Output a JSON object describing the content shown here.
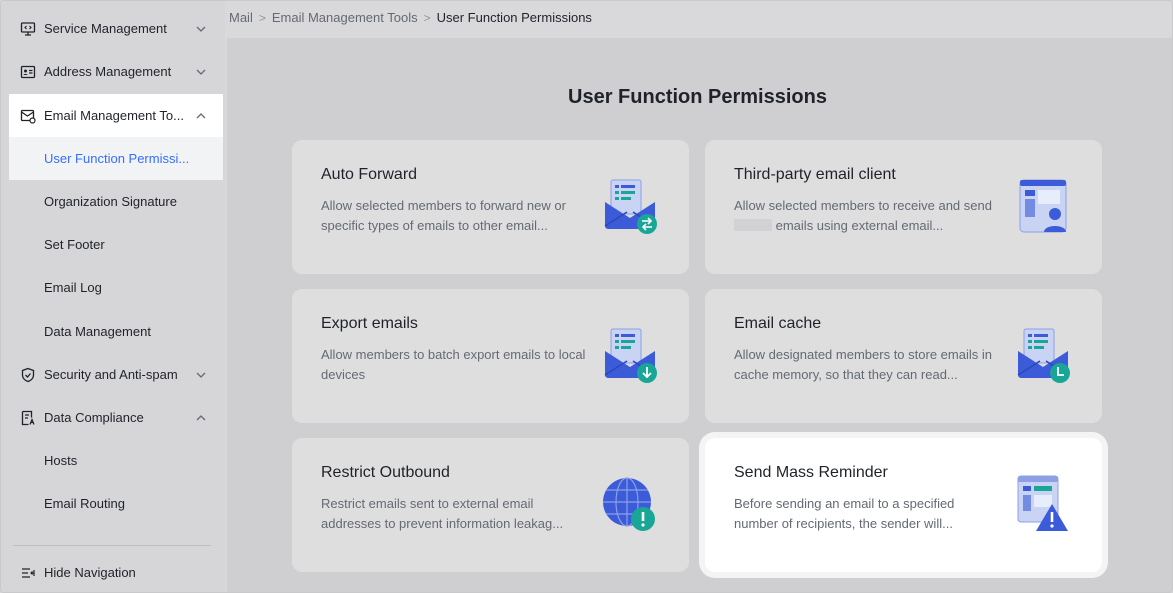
{
  "sidebar": {
    "items": [
      {
        "label": "Service Management",
        "icon": "code-monitor-icon",
        "expanded": false
      },
      {
        "label": "Address Management",
        "icon": "contact-card-icon",
        "expanded": false
      },
      {
        "label": "Email Management To...",
        "icon": "mail-settings-icon",
        "expanded": true
      },
      {
        "label": "User Function Permissi..."
      },
      {
        "label": "Organization Signature"
      },
      {
        "label": "Set Footer"
      },
      {
        "label": "Email Log"
      },
      {
        "label": "Data Management"
      },
      {
        "label": "Security and Anti-spam",
        "icon": "shield-check-icon",
        "expanded": false
      },
      {
        "label": "Data Compliance",
        "icon": "compliance-doc-icon",
        "expanded": true
      },
      {
        "label": "Hosts"
      },
      {
        "label": "Email Routing"
      }
    ],
    "hide_nav_label": "Hide Navigation"
  },
  "breadcrumb": {
    "items": [
      "Mail",
      "Email Management Tools",
      "User Function Permissions"
    ],
    "separator": ">"
  },
  "page": {
    "title": "User Function Permissions"
  },
  "cards": [
    {
      "title": "Auto Forward",
      "desc": "Allow selected members to forward new or specific types of emails to other email...",
      "icon": "mail-forward-icon"
    },
    {
      "title": "Third-party email client",
      "desc_a": "Allow selected members to receive and send",
      "desc_b": "emails using external email...",
      "icon": "client-user-icon"
    },
    {
      "title": "Export emails",
      "desc": "Allow members to batch export emails to local devices",
      "icon": "mail-download-icon"
    },
    {
      "title": "Email cache",
      "desc": "Allow designated members to store emails in cache memory, so that they can read...",
      "icon": "mail-clock-icon"
    },
    {
      "title": "Restrict Outbound",
      "desc": "Restrict emails sent to external email addresses to prevent information leakag...",
      "icon": "globe-alert-icon"
    },
    {
      "title": "Send Mass Reminder",
      "desc": "Before sending an email to a specified number of recipients, the sender will...",
      "icon": "window-warning-icon"
    }
  ],
  "colors": {
    "accent": "#3370ff",
    "illustration_blue": "#3b5bd9",
    "illustration_teal": "#19a697"
  }
}
